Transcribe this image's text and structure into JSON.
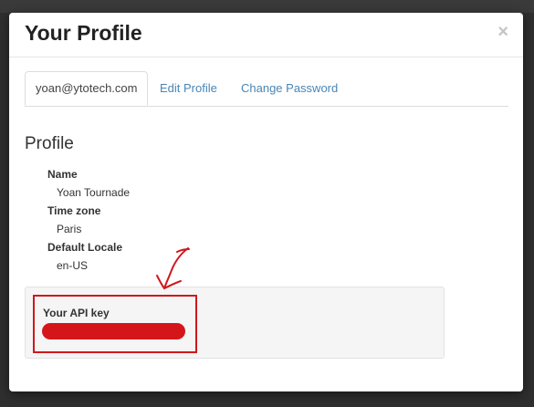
{
  "modal": {
    "title": "Your Profile",
    "close_glyph": "×"
  },
  "tabs": [
    {
      "label": "yoan@ytotech.com",
      "active": true
    },
    {
      "label": "Edit Profile",
      "active": false
    },
    {
      "label": "Change Password",
      "active": false
    }
  ],
  "profile": {
    "section_title": "Profile",
    "fields": [
      {
        "label": "Name",
        "value": "Yoan Tournade"
      },
      {
        "label": "Time zone",
        "value": "Paris"
      },
      {
        "label": "Default Locale",
        "value": "en-US"
      }
    ]
  },
  "api": {
    "label": "Your API key",
    "value_redacted": true
  },
  "colors": {
    "link": "#4a86b4",
    "annotation_red": "#d0181c"
  },
  "icons": {
    "close": "close-icon",
    "annotation_arrow": "arrow-annotation-icon"
  }
}
